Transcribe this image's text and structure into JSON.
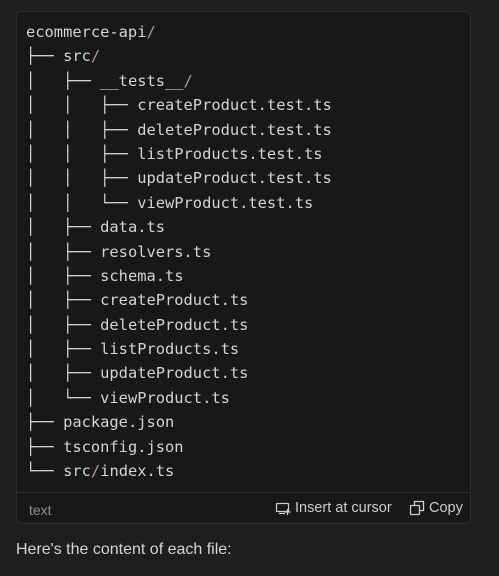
{
  "code_block": {
    "lines": [
      {
        "prefix": "",
        "name": "ecommerce-api",
        "slash": "/"
      },
      {
        "prefix": "├── ",
        "name": "src",
        "slash": "/"
      },
      {
        "prefix": "│   ├── ",
        "name": "__tests__",
        "slash": "/"
      },
      {
        "prefix": "│   │   ├── ",
        "name": "createProduct.test.ts",
        "slash": ""
      },
      {
        "prefix": "│   │   ├── ",
        "name": "deleteProduct.test.ts",
        "slash": ""
      },
      {
        "prefix": "│   │   ├── ",
        "name": "listProducts.test.ts",
        "slash": ""
      },
      {
        "prefix": "│   │   ├── ",
        "name": "updateProduct.test.ts",
        "slash": ""
      },
      {
        "prefix": "│   │   └── ",
        "name": "viewProduct.test.ts",
        "slash": ""
      },
      {
        "prefix": "│   ├── ",
        "name": "data.ts",
        "slash": ""
      },
      {
        "prefix": "│   ├── ",
        "name": "resolvers.ts",
        "slash": ""
      },
      {
        "prefix": "│   ├── ",
        "name": "schema.ts",
        "slash": ""
      },
      {
        "prefix": "│   ├── ",
        "name": "createProduct.ts",
        "slash": ""
      },
      {
        "prefix": "│   ├── ",
        "name": "deleteProduct.ts",
        "slash": ""
      },
      {
        "prefix": "│   ├── ",
        "name": "listProducts.ts",
        "slash": ""
      },
      {
        "prefix": "│   ├── ",
        "name": "updateProduct.ts",
        "slash": ""
      },
      {
        "prefix": "│   └── ",
        "name": "viewProduct.ts",
        "slash": ""
      },
      {
        "prefix": "├── ",
        "name": "package.json",
        "slash": ""
      },
      {
        "prefix": "├── ",
        "name": "tsconfig.json",
        "slash": ""
      },
      {
        "prefix": "└── ",
        "name": "src",
        "slash": "/",
        "suffix": "index.ts"
      }
    ],
    "language": "text",
    "insert_label": "Insert at cursor",
    "copy_label": "Copy"
  },
  "after_text": "Here's the content of each file:",
  "colors": {
    "background": "#1e1e1e",
    "code_background": "#181818",
    "text": "#d4d4d4",
    "slash_accent": "#c586c0",
    "muted": "#8b8b8b"
  },
  "icons": {
    "insert": "insert-at-cursor-icon",
    "copy": "copy-icon"
  }
}
